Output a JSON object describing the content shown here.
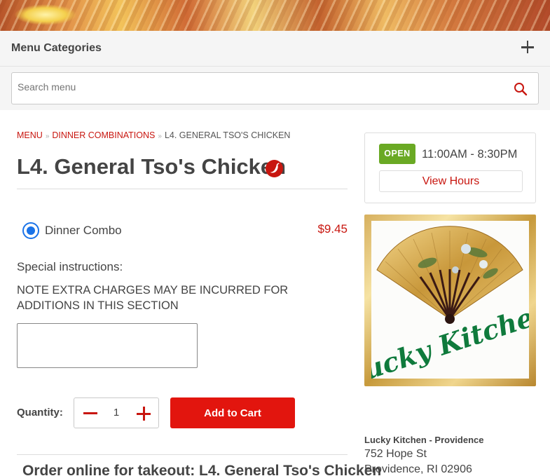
{
  "categories": {
    "title": "Menu Categories"
  },
  "search": {
    "placeholder": "Search menu"
  },
  "breadcrumb": {
    "menu": "Menu",
    "category": "Dinner Combinations",
    "current": "L4. General Tso's Chicken"
  },
  "item": {
    "title": "L4. General Tso's Chicken",
    "spicy_icon": "spicy-pepper-icon",
    "options": [
      {
        "label": "Dinner Combo",
        "price": "$9.45",
        "selected": true
      }
    ],
    "instructions_label": "Special instructions:",
    "instructions_note": "NOTE EXTRA CHARGES MAY BE INCURRED FOR ADDITIONS IN THIS SECTION",
    "instructions_value": "",
    "quantity_label": "Quantity:",
    "quantity": "1",
    "add_to_cart": "Add to Cart",
    "order_online": "Order online for takeout: L4. General Tso's Chicken"
  },
  "hours": {
    "status": "OPEN",
    "range": "11:00AM - 8:30PM",
    "view_hours": "View Hours"
  },
  "restaurant": {
    "logo_text": "Lucky Kitchen",
    "name": "Lucky Kitchen - Providence",
    "street": "752 Hope St",
    "city": "Providence, RI 02906"
  },
  "colors": {
    "accent": "#c8160f",
    "button": "#e2150e",
    "open": "#6aa924",
    "radio": "#1a73e8"
  }
}
